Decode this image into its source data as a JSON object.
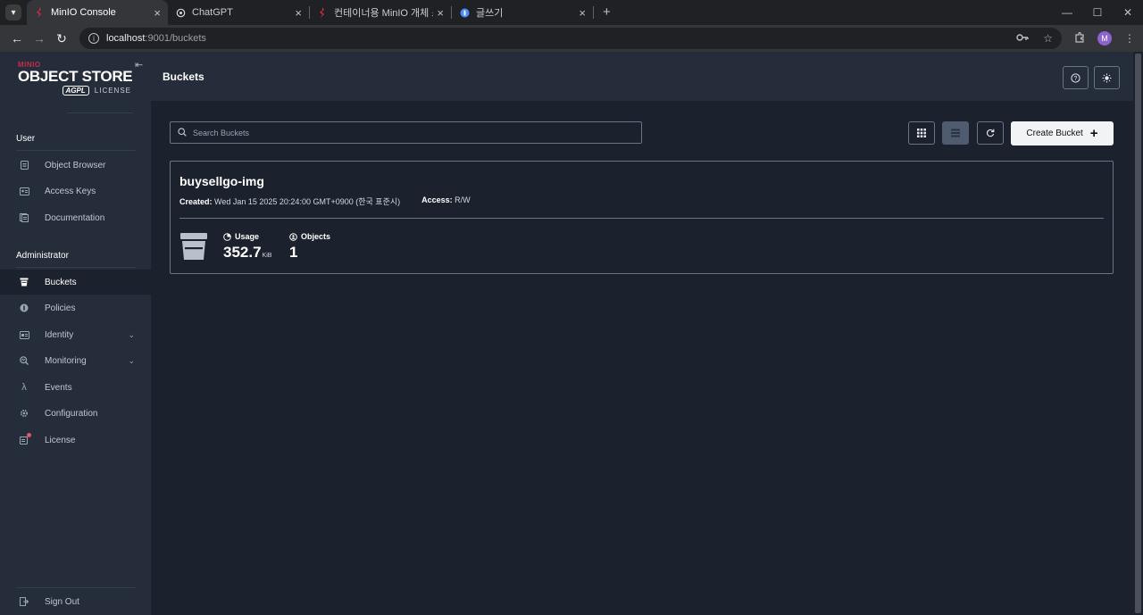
{
  "browser": {
    "tabs": [
      {
        "title": "MinIO Console",
        "active": true,
        "icon": "minio-favicon"
      },
      {
        "title": "ChatGPT",
        "active": false,
        "icon": "chatgpt-favicon"
      },
      {
        "title": "컨테이너용 MinIO 개체 스토리",
        "active": false,
        "icon": "minio-favicon"
      },
      {
        "title": "글쓰기",
        "active": false,
        "icon": "blog-favicon"
      }
    ],
    "url_host": "localhost",
    "url_path": ":9001/buckets",
    "profile_initial": "M"
  },
  "logo": {
    "brand": "MINIO",
    "product": "OBJECT STORE",
    "agpl": "AGPL",
    "license": "LICENSE"
  },
  "sidebar": {
    "user_section": "User",
    "user_items": [
      {
        "label": "Object Browser",
        "icon": "object-browser-icon"
      },
      {
        "label": "Access Keys",
        "icon": "access-keys-icon"
      },
      {
        "label": "Documentation",
        "icon": "documentation-icon"
      }
    ],
    "admin_section": "Administrator",
    "admin_items": [
      {
        "label": "Buckets",
        "icon": "bucket-icon",
        "active": true
      },
      {
        "label": "Policies",
        "icon": "policies-icon"
      },
      {
        "label": "Identity",
        "icon": "identity-icon",
        "expandable": true
      },
      {
        "label": "Monitoring",
        "icon": "monitoring-icon",
        "expandable": true
      },
      {
        "label": "Events",
        "icon": "lambda-icon"
      },
      {
        "label": "Configuration",
        "icon": "gear-icon"
      },
      {
        "label": "License",
        "icon": "license-icon"
      }
    ],
    "sign_out": "Sign Out"
  },
  "header": {
    "title": "Buckets"
  },
  "toolbar": {
    "search_placeholder": "Search Buckets",
    "create_label": "Create Bucket"
  },
  "bucket": {
    "name": "buysellgo-img",
    "created_label": "Created:",
    "created_value": "Wed Jan 15 2025 20:24:00 GMT+0900 (한국 표준시)",
    "access_label": "Access:",
    "access_value": "R/W",
    "usage_label": "Usage",
    "usage_value": "352.7",
    "usage_unit": "KiB",
    "objects_label": "Objects",
    "objects_value": "1"
  },
  "colors": {
    "sidebar_bg": "#252d3a",
    "main_bg": "#1c222d",
    "minio_red": "#c72c48"
  }
}
